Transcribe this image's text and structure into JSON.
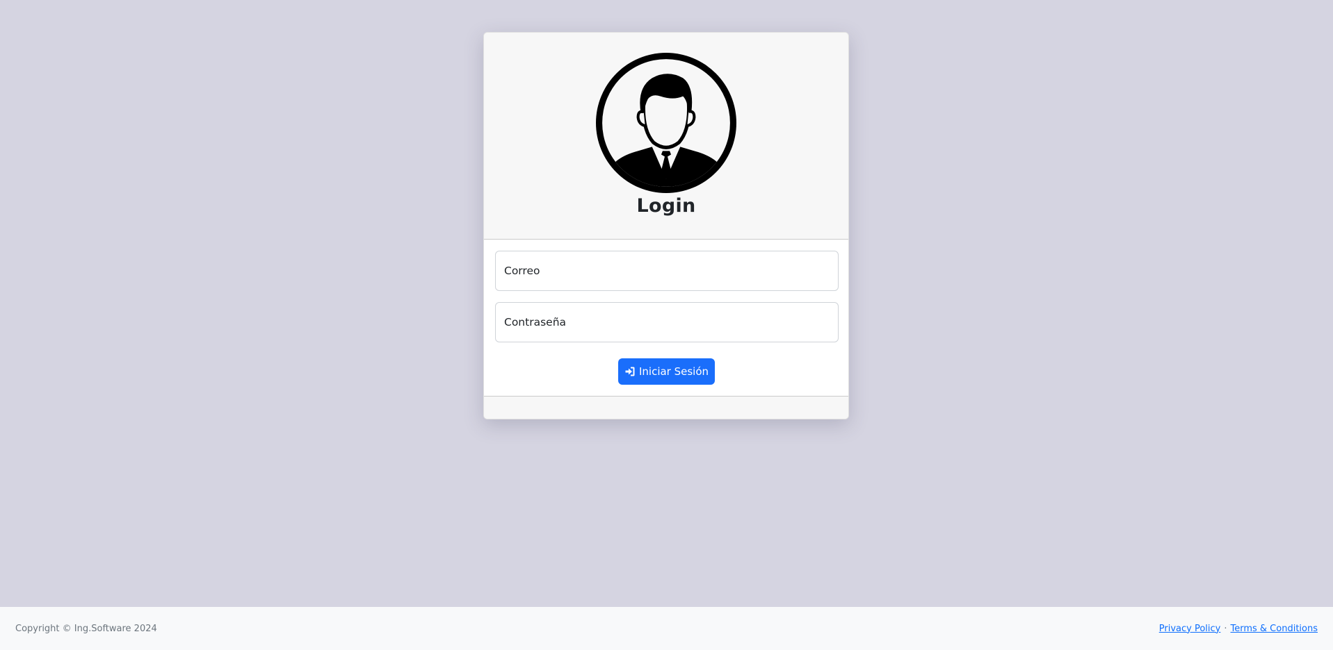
{
  "login_card": {
    "title": "Login",
    "avatar_icon": "user-avatar-icon",
    "email_placeholder": "Correo",
    "email_value": "",
    "password_placeholder": "Contraseña",
    "password_value": "",
    "submit_label": "Iniciar Sesión",
    "submit_icon": "sign-in-icon"
  },
  "footer": {
    "copyright": "Copyright © Ing.Software 2024",
    "privacy_label": "Privacy Policy",
    "separator": "·",
    "terms_label": "Terms & Conditions"
  },
  "colors": {
    "background": "#d5d4e1",
    "primary": "#1a6efb",
    "card_header": "#f7f7f7",
    "footer_bg": "#f8f9fa",
    "link": "#0d6efd"
  }
}
